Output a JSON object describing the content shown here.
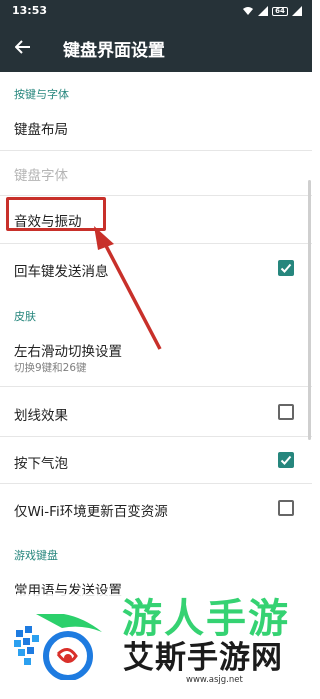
{
  "status_bar": {
    "time": "13:53",
    "battery": "64"
  },
  "app_bar": {
    "title": "键盘界面设置"
  },
  "sections": {
    "keys_fonts": "按键与字体",
    "skin": "皮肤",
    "game_keyboard": "游戏键盘"
  },
  "items": {
    "keyboard_layout": "键盘布局",
    "keyboard_font": "键盘字体",
    "sound_vibration": "音效与振动",
    "enter_send": "回车键发送消息",
    "swipe_switch": "左右滑动切换设置",
    "swipe_switch_sub": "切换9键和26键",
    "swipe_effect": "划线效果",
    "press_bubble": "按下气泡",
    "wifi_update": "仅Wi-Fi环境更新百变资源",
    "common_phrases": "常用语与发送设置"
  },
  "checkboxes": {
    "enter_send": true,
    "swipe_effect": false,
    "press_bubble": true,
    "wifi_update": false
  },
  "watermark": {
    "big_text": "游人手游",
    "site_name": "艾斯手游网",
    "url": "www.asjg.net"
  },
  "colors": {
    "app_bar": "#263238",
    "accent": "#26867d",
    "highlight": "#c8302a"
  }
}
